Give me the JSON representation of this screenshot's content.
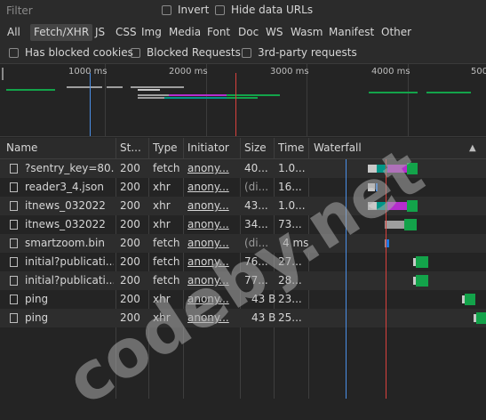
{
  "toolbar": {
    "filter_placeholder": "Filter",
    "invert_label": "Invert",
    "hide_data_urls_label": "Hide data URLs"
  },
  "types": [
    "All",
    "Fetch/XHR",
    "JS",
    "CSS",
    "Img",
    "Media",
    "Font",
    "Doc",
    "WS",
    "Wasm",
    "Manifest",
    "Other"
  ],
  "active_type": "Fetch/XHR",
  "options": {
    "blocked_cookies": "Has blocked cookies",
    "blocked_requests": "Blocked Requests",
    "third_party": "3rd-party requests"
  },
  "overview": {
    "ticks": [
      "1000 ms",
      "2000 ms",
      "3000 ms",
      "4000 ms",
      "500"
    ]
  },
  "table": {
    "headers": {
      "name": "Name",
      "status": "St...",
      "type": "Type",
      "initiator": "Initiator",
      "size": "Size",
      "time": "Time",
      "waterfall": "Waterfall",
      "sort_icon": "▲"
    },
    "rows": [
      {
        "name": "?sentry_key=80...",
        "status": "200",
        "type": "fetch",
        "initiator": "anony...",
        "size": "40...",
        "time": "1.0..."
      },
      {
        "name": "reader3_4.json",
        "status": "200",
        "type": "xhr",
        "initiator": "anony...",
        "size": "(di...",
        "time": "16..."
      },
      {
        "name": "itnews_032022",
        "status": "200",
        "type": "xhr",
        "initiator": "anony...",
        "size": "43...",
        "time": "1.0..."
      },
      {
        "name": "itnews_032022",
        "status": "200",
        "type": "xhr",
        "initiator": "anony...",
        "size": "34...",
        "time": "73..."
      },
      {
        "name": "smartzoom.bin",
        "status": "200",
        "type": "fetch",
        "initiator": "anony...",
        "size": "(di...",
        "time": "4 ms"
      },
      {
        "name": "initial?publicati...",
        "status": "200",
        "type": "fetch",
        "initiator": "anony...",
        "size": "76...",
        "time": "27..."
      },
      {
        "name": "initial?publicati...",
        "status": "200",
        "type": "fetch",
        "initiator": "anony...",
        "size": "77...",
        "time": "28..."
      },
      {
        "name": "ping",
        "status": "200",
        "type": "xhr",
        "initiator": "anony...",
        "size": "43 B",
        "time": "23..."
      },
      {
        "name": "ping",
        "status": "200",
        "type": "xhr",
        "initiator": "anony...",
        "size": "43 B",
        "time": "25..."
      }
    ]
  },
  "watermark": "codeby.net",
  "colors": {
    "queue": "#9e9e9e",
    "stalled": "#c8c8c8",
    "dns": "#009688",
    "ssl": "#b52dcd",
    "waiting": "#13a34a",
    "download": "#1f7ae6",
    "dom_content_loaded": "#4a8fe7",
    "load_marker": "#d9413d"
  }
}
